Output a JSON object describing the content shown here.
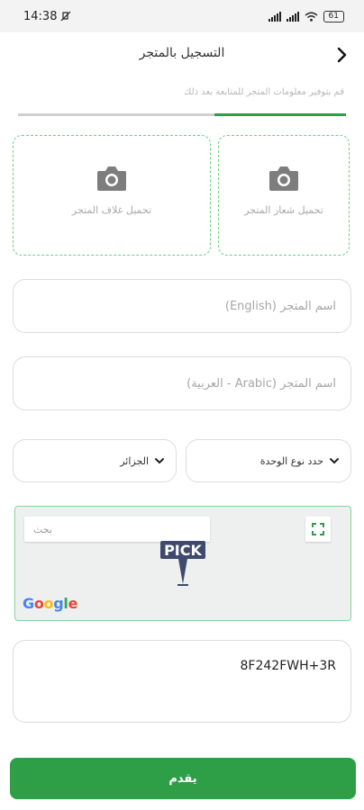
{
  "status_bar": {
    "time": "14:38",
    "battery": "61"
  },
  "header": {
    "title": "التسجيل بالمتجر"
  },
  "subtitle": "قم بتوفير معلومات المتجر للمتابعة بعد ذلك",
  "progress": {
    "fraction": 0.4
  },
  "uploads": {
    "logo_label": "تحميل شعار المتجر",
    "cover_label": "تحميل غلاف المتجر"
  },
  "fields": {
    "store_name_en_placeholder": "اسم المتجر (English)",
    "store_name_ar_placeholder": "اسم المتجر (Arabic - العربية)"
  },
  "dropdowns": {
    "unit_type": "حدد نوع الوحدة",
    "country": "الجزائر"
  },
  "map": {
    "search_placeholder": "بحث",
    "pin_label": "PICK",
    "google_logo": "Google"
  },
  "location": {
    "plus_code": "8F242FWH+3R"
  },
  "submit_label": "يقدم",
  "colors": {
    "primary": "#2e9e47",
    "dashed_border": "#6ccf86",
    "map_border": "#8bd39b"
  },
  "icons": [
    "back-arrow-icon",
    "camera-icon",
    "chevron-down-icon",
    "fullscreen-icon",
    "map-pin-icon"
  ]
}
